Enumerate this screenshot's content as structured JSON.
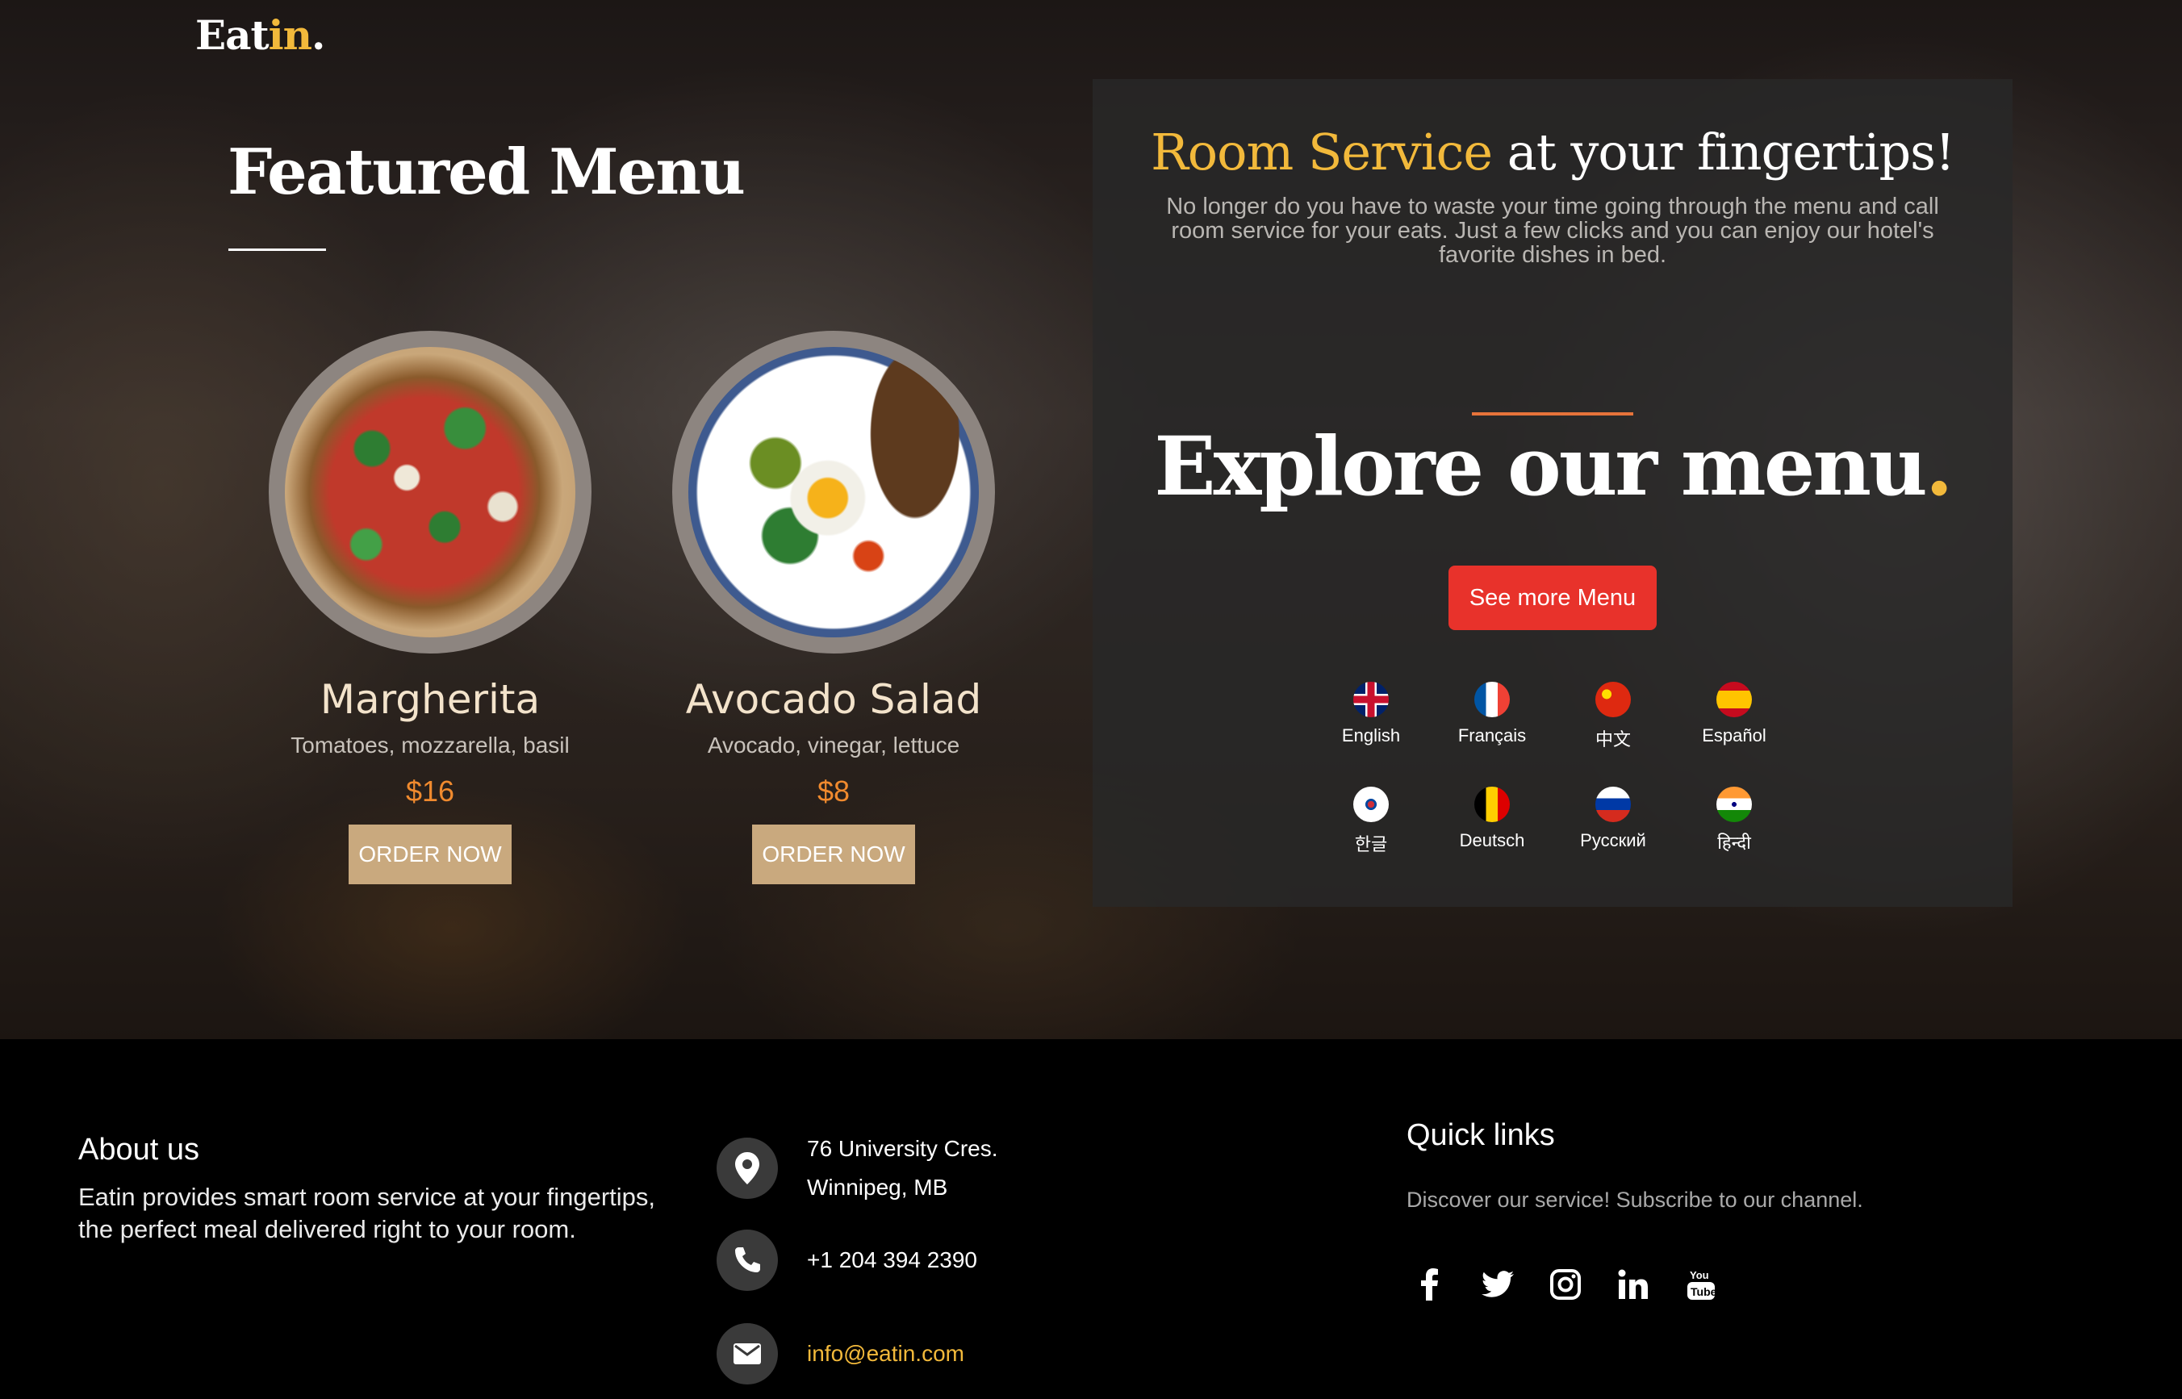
{
  "logo": {
    "main": "Eat",
    "accent": "in",
    "dot": "."
  },
  "featured": {
    "title": "Featured Menu",
    "items": [
      {
        "name": "Margherita",
        "desc": "Tomatoes, mozzarella, basil",
        "price": "$16",
        "button": "ORDER NOW"
      },
      {
        "name": "Avocado Salad",
        "desc": "Avocado, vinegar, lettuce",
        "price": "$8",
        "button": "ORDER NOW"
      }
    ]
  },
  "panel": {
    "heading_accent": "Room Service",
    "heading_rest": " at your fingertips!",
    "text": "No longer do you have to waste your time going through the menu and call room service for your eats. Just a few clicks and you can enjoy our hotel's favorite dishes in bed.",
    "explore": "Explore our menu",
    "explore_dot": ".",
    "button": "See more Menu",
    "languages": [
      "English",
      "Français",
      "中文",
      "Español",
      "한글",
      "Deutsch",
      "Русский",
      "हिन्दी"
    ]
  },
  "footer": {
    "about_title": "About us",
    "about_text": "Eatin provides smart room service at your fingertips, the perfect meal delivered right to your room.",
    "address_line1": "76 University Cres.",
    "address_line2": "Winnipeg, MB",
    "phone": "+1 204 394 2390",
    "email": "info@eatin.com",
    "quick_links_title": "Quick links",
    "quick_links_text": "Discover our service! Subscribe to our channel.",
    "socials": [
      "facebook-icon",
      "twitter-icon",
      "instagram-icon",
      "linkedin-icon",
      "youtube-icon"
    ]
  },
  "colors": {
    "accent": "#f2b93b",
    "price": "#f08a2e",
    "cta": "#e8322b",
    "order": "#c9a97e"
  }
}
